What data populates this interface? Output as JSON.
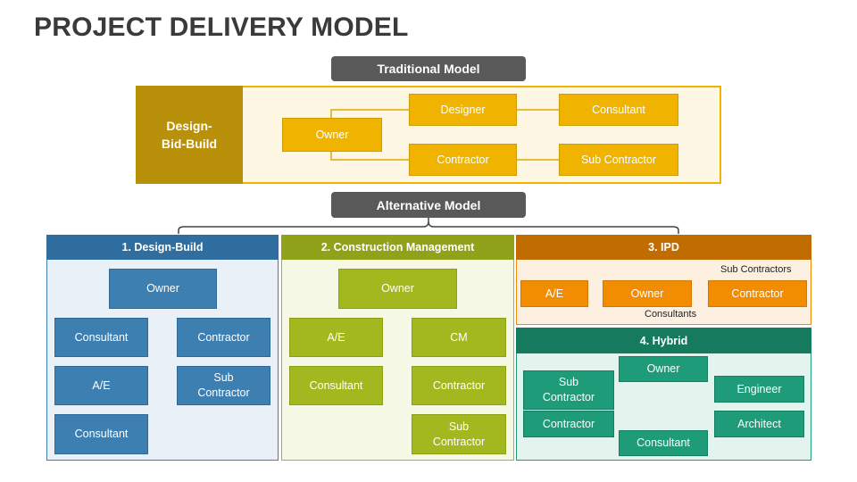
{
  "title": "PROJECT DELIVERY MODEL",
  "traditional": {
    "header": "Traditional Model",
    "label": "Design-\nBid-Build",
    "label_line1": "Design-",
    "label_line2": "Bid-Build",
    "nodes": {
      "owner": "Owner",
      "designer": "Designer",
      "consultant": "Consultant",
      "contractor": "Contractor",
      "sub_contractor": "Sub Contractor"
    }
  },
  "alternative": {
    "header": "Alternative Model",
    "design_build": {
      "header": "1. Design-Build",
      "nodes": {
        "owner": "Owner",
        "consultant": "Consultant",
        "contractor": "Contractor",
        "ae": "A/E",
        "sub_contractor_1": "Sub",
        "sub_contractor_2": "Contractor",
        "consultant_2": "Consultant"
      }
    },
    "construction_management": {
      "header": "2. Construction Management",
      "nodes": {
        "owner": "Owner",
        "ae": "A/E",
        "cm": "CM",
        "consultant": "Consultant",
        "contractor": "Contractor",
        "sub_contractor_1": "Sub",
        "sub_contractor_2": "Contractor"
      }
    },
    "ipd": {
      "header": "3. IPD",
      "nodes": {
        "ae": "A/E",
        "owner": "Owner",
        "contractor": "Contractor"
      },
      "labels": {
        "sub_contractors": "Sub Contractors",
        "consultants": "Consultants"
      }
    },
    "hybrid": {
      "header": "4. Hybrid",
      "nodes": {
        "owner": "Owner",
        "sub_contractor_1": "Sub",
        "sub_contractor_2": "Contractor",
        "contractor": "Contractor",
        "engineer": "Engineer",
        "architect": "Architect",
        "consultant": "Consultant"
      }
    }
  },
  "colors": {
    "traditional": "#f0b400",
    "traditional_dark": "#b8900a",
    "design_build": "#3d7fb0",
    "construction_management": "#a3b81f",
    "ipd": "#f28c00",
    "hybrid": "#1e9b78",
    "pill": "#595959"
  }
}
